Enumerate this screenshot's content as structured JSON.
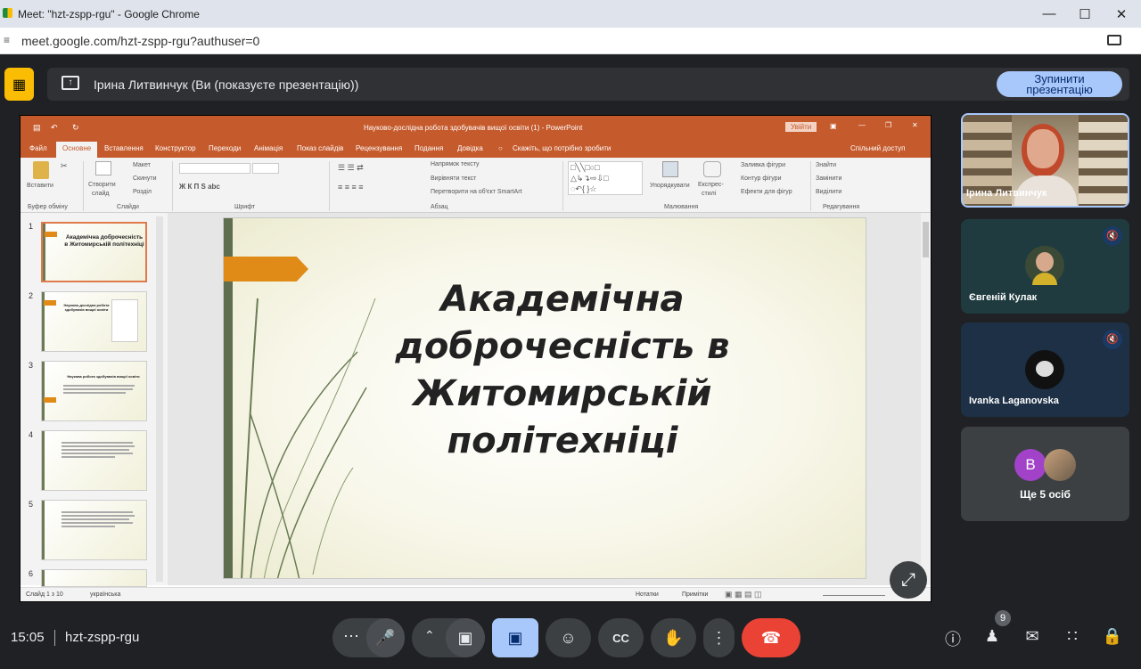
{
  "browser": {
    "tab_title": "Meet: \"hzt-zspp-rgu\" - Google Chrome",
    "url": "meet.google.com/hzt-zspp-rgu?authuser=0"
  },
  "sharing": {
    "banner_text": "Ірина Литвинчук (Ви (показуєте презентацію))",
    "stop_line1": "Зупинити",
    "stop_line2": "презентацію"
  },
  "ppt": {
    "title": "Науково-дослідна робота здобувачів вищої освіти (1) - PowerPoint",
    "signin": "Увійти",
    "tabs": [
      "Файл",
      "Основне",
      "Вставлення",
      "Конструктор",
      "Переходи",
      "Анімація",
      "Показ слайдів",
      "Рецензування",
      "Подання",
      "Довідка",
      "Скажіть, що потрібно зробити"
    ],
    "share": "Спільний доступ",
    "ribbon": {
      "paste": "Вставити",
      "clipboard": "Буфер обміну",
      "new_slide_1": "Створити",
      "new_slide_2": "слайд",
      "layout": "Макет",
      "reset": "Скинути",
      "section": "Розділ",
      "slides": "Слайди",
      "font": "Шрифт",
      "paragraph": "Абзац",
      "text_dir": "Напрямок тексту",
      "align_text": "Вирівняти текст",
      "smartart": "Перетворити на об'єкт SmartArt",
      "arrange": "Упорядкувати",
      "quick_1": "Експрес-",
      "quick_2": "стилі",
      "fill": "Заливка фігури",
      "outline": "Контур фігури",
      "effects": "Ефекти для фігур",
      "drawing": "Малювання",
      "find": "Знайти",
      "replace": "Замінити",
      "select": "Виділити",
      "editing": "Редагування"
    },
    "thumbs": [
      {
        "n": "1",
        "text": "Академічна доброчесність в Житомирській політехніці"
      },
      {
        "n": "2",
        "text": "Науково-дослідна робота здобувачів вищої освіти"
      },
      {
        "n": "3",
        "text": "Наукова робота здобувачів вищої освіти"
      },
      {
        "n": "4",
        "text": ""
      },
      {
        "n": "5",
        "text": ""
      },
      {
        "n": "6",
        "text": ""
      }
    ],
    "slide_title": "Академічна доброчесність в Житомирській політехніці",
    "status": {
      "slide": "Слайд 1 з 10",
      "lang": "українська",
      "notes": "Нотатки",
      "comments": "Примітки"
    }
  },
  "participants": [
    {
      "name": "Ірина Литвинчук"
    },
    {
      "name": "Євгеній Кулак"
    },
    {
      "name": "Ivanka Laganovska"
    }
  ],
  "more": {
    "avatar_letter": "B",
    "label": "Ще 5 осіб"
  },
  "bottom": {
    "time": "15:05",
    "code": "hzt-zspp-rgu",
    "people_count": "9"
  }
}
